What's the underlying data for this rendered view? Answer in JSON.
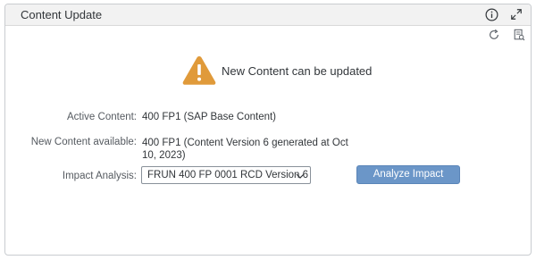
{
  "window": {
    "title": "Content Update",
    "icons": {
      "info": "info-icon",
      "expand": "expand-icon",
      "refresh": "refresh-icon",
      "log": "log-icon"
    }
  },
  "status": {
    "icon": "warning-icon",
    "message": "New Content can be updated",
    "color": "#e09a3a"
  },
  "fields": {
    "active_content_label": "Active Content:",
    "active_content_value": "400 FP1 (SAP Base Content)",
    "new_content_label": "New Content available:",
    "new_content_value": "400 FP1 (Content Version 6 generated at Oct 10, 2023)",
    "impact_analysis_label": "Impact Analysis:",
    "impact_analysis_selected": "FRUN 400 FP 0001 RCD Version 6"
  },
  "actions": {
    "analyze_label": "Analyze Impact",
    "accent": "#6b96c8"
  }
}
